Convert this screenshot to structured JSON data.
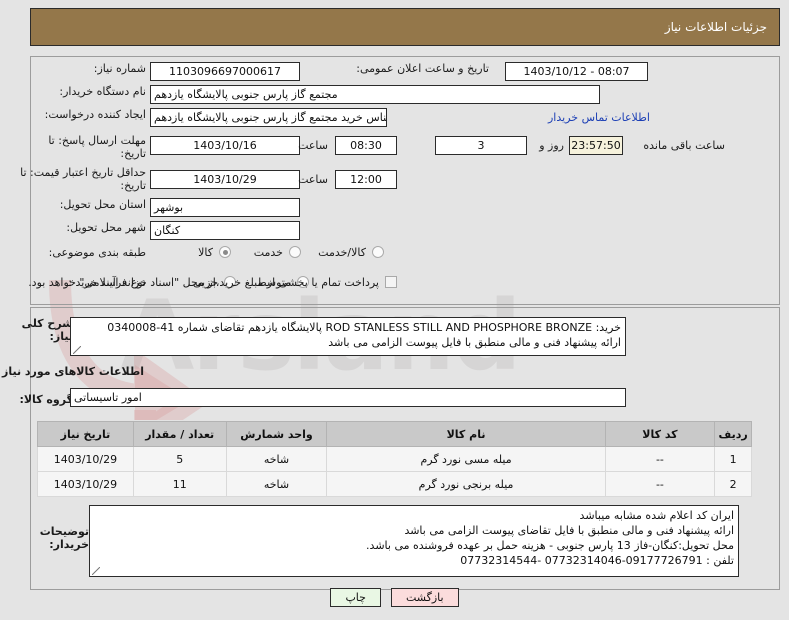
{
  "header": {
    "title": "جزئیات اطلاعات نیاز"
  },
  "form": {
    "need_number_label": "شماره نیاز:",
    "need_number_value": "1103096697000617",
    "public_announce_label": "تاریخ و ساعت اعلان عمومی:",
    "public_announce_value": "08:07 - 1403/10/12",
    "buyer_org_label": "نام دستگاه خریدار:",
    "buyer_org_value": "مجتمع گاز پارس جنوبی  پالایشگاه یازدهم",
    "requester_label": "ایجاد کننده درخواست:",
    "requester_value": "فرهاد محمودی کارشناس خرید مجتمع گاز پارس جنوبی  پالایشگاه یازدهم",
    "contact_link": "اطلاعات تماس خریدار",
    "deadline_label": "مهلت ارسال پاسخ: تا تاریخ:",
    "deadline_date": "1403/10/16",
    "hour_label": "ساعت",
    "deadline_time": "08:30",
    "remaining_days": "3",
    "days_and_label": "روز و",
    "remaining_clock": "23:57:50",
    "remaining_suffix": "ساعت باقی مانده",
    "price_validity_label": "حداقل تاریخ اعتبار قیمت: تا تاریخ:",
    "price_validity_date": "1403/10/29",
    "price_validity_time": "12:00",
    "province_label": "استان محل تحویل:",
    "province_value": "بوشهر",
    "city_label": "شهر محل تحویل:",
    "city_value": "کنگان",
    "category_label": "طبقه بندی موضوعی:",
    "category_options": [
      {
        "label": "کالا",
        "selected": true
      },
      {
        "label": "خدمت",
        "selected": false
      },
      {
        "label": "کالا/خدمت",
        "selected": false
      }
    ],
    "process_type_label": "نوع فرآیند خرید :",
    "process_options": [
      {
        "label": "جزیی",
        "selected": false
      },
      {
        "label": "متوسط",
        "selected": false
      }
    ],
    "treasury_checkbox_label": "پرداخت تمام یا بخشی از مبلغ خرید،از محل \"اسناد خزانه اسلامی\" خواهد بود.",
    "treasury_checked": false,
    "description_label": "شرح کلی نیاز:",
    "description_line1": "خرید:   ROD STANLESS STILL AND PHOSPHORE BRONZE  پالایشگاه یازدهم تقاضای شماره 41-0340008",
    "description_line2": "ارائه پیشنهاد فنی و مالی منطبق با فایل پیوست الزامی می باشد",
    "goods_info_heading": "اطلاعات کالاهای مورد نیاز",
    "goods_group_label": "گروه کالا:",
    "goods_group_value": "امور تاسیساتی",
    "buyer_notes_label": "توضیحات خریدار:",
    "buyer_notes_line1": "ایران کد اعلام شده مشابه میباشد",
    "buyer_notes_line2": "ارائه پیشنهاد فنی و مالی منطبق با فایل تقاضای پیوست الزامی می باشد",
    "buyer_notes_line3": "محل تحویل:کنگان-فاز 13 پارس جنوبی - هزینه حمل بر عهده فروشنده می باشد.",
    "buyer_notes_line4": "تلفن : 09177726791-07732314046 -07732314544"
  },
  "table": {
    "headers": [
      "ردیف",
      "کد کالا",
      "نام کالا",
      "واحد شمارش",
      "تعداد / مقدار",
      "تاریخ نیاز"
    ],
    "rows": [
      {
        "index": "1",
        "code": "--",
        "name": "میله مسی نورد گرم",
        "unit": "شاخه",
        "qty": "5",
        "date": "1403/10/29"
      },
      {
        "index": "2",
        "code": "--",
        "name": "میله برنجی نورد گرم",
        "unit": "شاخه",
        "qty": "11",
        "date": "1403/10/29"
      }
    ]
  },
  "buttons": {
    "print": "چاپ",
    "back": "بازگشت"
  },
  "watermark": {
    "text": "Arsland"
  },
  "colors": {
    "header_brown": "#94774a",
    "link_blue": "#1c3fb5",
    "countdown_cream": "#f6f2dc",
    "btn_print_green": "#e9f7e4",
    "btn_back_pink": "#fbdcdc"
  }
}
